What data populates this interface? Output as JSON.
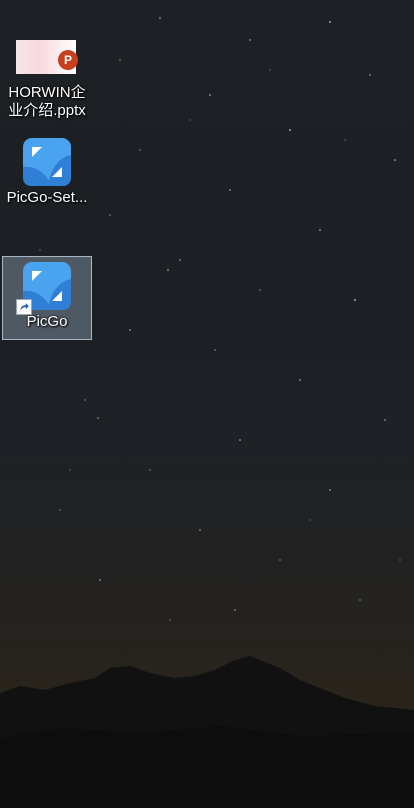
{
  "desktop": {
    "icons": [
      {
        "label": "HORWIN企业介绍.pptx",
        "type": "powerpoint-file",
        "badge": "P",
        "selected": false
      },
      {
        "label": "PicGo-Set...",
        "type": "installer",
        "selected": false
      },
      {
        "label": "PicGo",
        "type": "shortcut",
        "selected": true
      }
    ]
  },
  "colors": {
    "picgo_blue": "#3d8ee0",
    "picgo_light": "#5aaaf0",
    "ppt_red": "#c4401f"
  }
}
